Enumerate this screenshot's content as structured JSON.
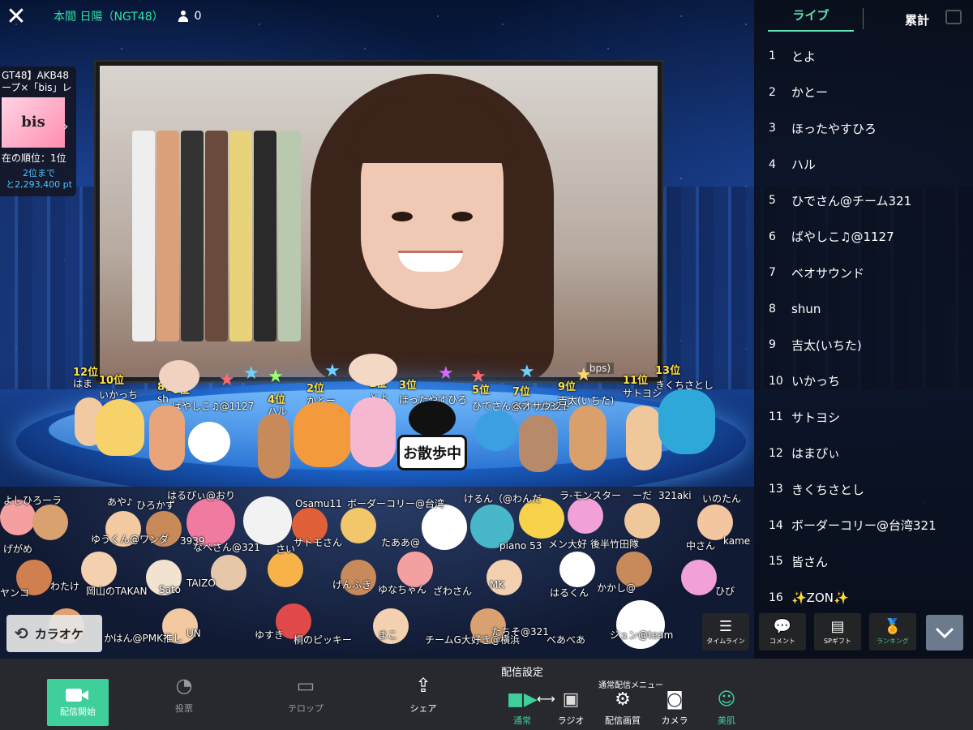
{
  "header": {
    "close_label": "✕",
    "broadcaster": "本間 日陽（NGT48）",
    "viewer_count": "0"
  },
  "event_banner": {
    "title_line1": "GT48】AKB48",
    "title_line2": "ープ×「bis」レ",
    "thumb_text": "bis",
    "rank_text": "在の順位：1位",
    "gap_line1": "2位まで",
    "gap_line2": "と2,293,400 pt"
  },
  "video": {
    "bitrate_text": "bps)"
  },
  "stage": {
    "ranks": [
      {
        "badge": "12位",
        "name": "はま"
      },
      {
        "badge": "10位",
        "name": "いかっち"
      },
      {
        "badge": "8位",
        "name": "sh"
      },
      {
        "badge": "6位",
        "name": "ばやしこ♫@1127"
      },
      {
        "badge": "4位",
        "name": "ハル"
      },
      {
        "badge": "2位",
        "name": "かとー"
      },
      {
        "badge": "1位",
        "name": "とよ"
      },
      {
        "badge": "3位",
        "name": "ほったやすひろ"
      },
      {
        "badge": "5位",
        "name": "ひでさん@チーム321"
      },
      {
        "badge": "7位",
        "name": "ベオサウンド"
      },
      {
        "badge": "9位",
        "name": "吉太(いちた)"
      },
      {
        "badge": "11位",
        "name": "サトヨシ"
      },
      {
        "badge": "13位",
        "name": "きくちさとし"
      }
    ],
    "sign_text": "お散歩中"
  },
  "crowd": {
    "names": [
      "よしひろーラ",
      "あや♪",
      "ひろかず",
      "はるぴぃ@おり",
      "Osamu11",
      "ボーダーコリー@台湾",
      "けるん（@わんだ",
      "ラ-モンスター",
      "ーだ",
      "321aki",
      "いのたん",
      "げがめ",
      "ゆうくん@ワンダ",
      "3939",
      "なべさん@321",
      "さい",
      "サトモさん",
      "たああ@",
      "piano 53",
      "メン大好",
      "後半竹田隊",
      "中さん",
      "kame",
      "ヤンコ",
      "わたけ",
      "岡山のTAKAN",
      "Sato",
      "TAIZO",
      "げんふき",
      "ゆなちゃん",
      "ざわさん",
      "MK",
      "はるくん",
      "かかし@",
      "ひび",
      "かはん@PMK推し",
      "UN",
      "ゆすき",
      "桐のピッキー",
      "まこ",
      "チームG大好き@横浜",
      "たちそ@321",
      "べあべあ",
      "ジュン@team"
    ]
  },
  "ranking_panel": {
    "tab_live": "ライブ",
    "tab_total": "累計",
    "items": [
      {
        "no": "1",
        "name": "とよ"
      },
      {
        "no": "2",
        "name": "かとー"
      },
      {
        "no": "3",
        "name": "ほったやすひろ"
      },
      {
        "no": "4",
        "name": "ハル"
      },
      {
        "no": "5",
        "name": "ひでさん@チーム321"
      },
      {
        "no": "6",
        "name": "ばやしこ♫@1127"
      },
      {
        "no": "7",
        "name": "ベオサウンド"
      },
      {
        "no": "8",
        "name": "shun"
      },
      {
        "no": "9",
        "name": "吉太(いちた)"
      },
      {
        "no": "10",
        "name": "いかっち"
      },
      {
        "no": "11",
        "name": "サトヨシ"
      },
      {
        "no": "12",
        "name": "はまぴぃ"
      },
      {
        "no": "13",
        "name": "きくちさとし"
      },
      {
        "no": "14",
        "name": "ボーダーコリー@台湾321"
      },
      {
        "no": "15",
        "name": "皆さん"
      },
      {
        "no": "16",
        "name": "✨ZON✨"
      }
    ]
  },
  "actions": {
    "karaoke": "カラオケ",
    "timeline": "タイムライン",
    "comment": "コメント",
    "sp_gift": "SPギフト",
    "ranking": "ランキング"
  },
  "toolbar": {
    "start": "配信開始",
    "vote": "投票",
    "telop": "テロップ",
    "share": "シェア",
    "settings_title": "配信設定",
    "settings_sub": "通常配信メニュー",
    "normal": "通常",
    "radio": "ラジオ",
    "quality": "配信画質",
    "camera": "カメラ",
    "beauty": "美肌"
  },
  "colors": {
    "accent": "#3fcf9b",
    "broadcaster_text": "#2fe2a2",
    "rank_badge": "#ffe14d",
    "toolbar_bg": "#28292e"
  }
}
